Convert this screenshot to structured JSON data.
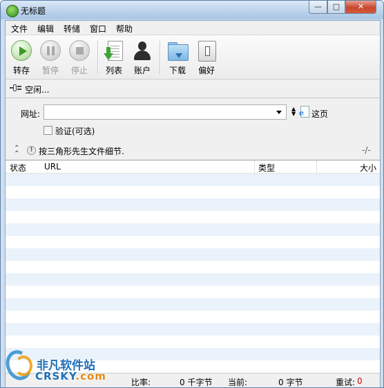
{
  "window": {
    "title": "无标题"
  },
  "menu": [
    "文件",
    "编辑",
    "转储",
    "窗口",
    "帮助"
  ],
  "toolbar": {
    "transfer": "转存",
    "pause": "暂停",
    "stop": "停止",
    "list": "列表",
    "account": "账户",
    "download": "下载",
    "preferences": "偏好"
  },
  "status": {
    "text": "空闲..."
  },
  "form": {
    "url_label": "网址:",
    "url_value": "",
    "this_page": "这页",
    "verify_label": "验证(可选)"
  },
  "info": {
    "text": "按三角形先生文件细节.",
    "counter": "-/-"
  },
  "list": {
    "columns": [
      "状态",
      "URL",
      "类型",
      "大小"
    ],
    "rows": []
  },
  "statusbar": {
    "ratio_label": "比率:",
    "ratio_value": "0 千字节",
    "current_label": "当前:",
    "current_value": "0 字节",
    "retry_label": "重试:",
    "retry_value": "0"
  },
  "watermark": {
    "cn": "非凡软件站",
    "en": "CRSKY",
    "en_suffix": ".com"
  },
  "colors": {
    "title_gradient": "#b9d1ea",
    "row_stripe": "#eaf2fb",
    "close_button": "#c7482e",
    "retry_value": "#d40000"
  }
}
